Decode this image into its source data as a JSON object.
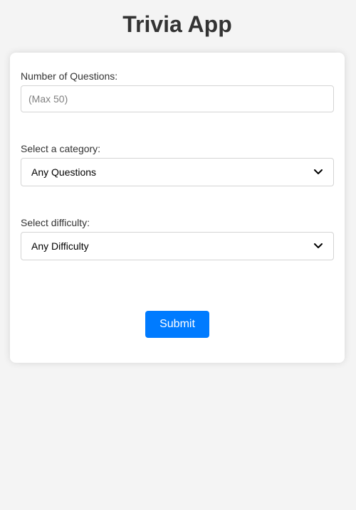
{
  "app": {
    "title": "Trivia App"
  },
  "form": {
    "questions": {
      "label": "Number of Questions:",
      "placeholder": "(Max 50)",
      "value": ""
    },
    "category": {
      "label": "Select a category:",
      "selected": "Any Questions"
    },
    "difficulty": {
      "label": "Select difficulty:",
      "selected": "Any Difficulty"
    },
    "submit_label": "Submit"
  },
  "colors": {
    "background": "#f4f4f4",
    "card": "#ffffff",
    "accent": "#007bff",
    "text": "#333333"
  },
  "icons": {
    "select_arrow": "chevron-down-icon"
  }
}
